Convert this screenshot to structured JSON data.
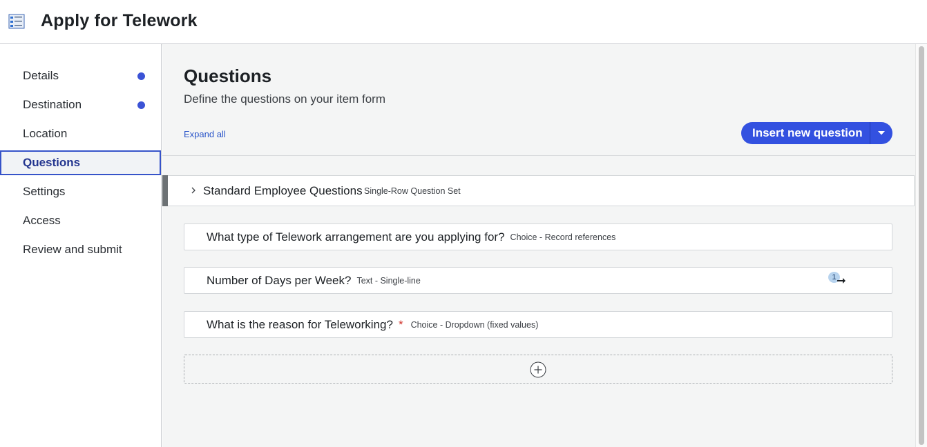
{
  "header": {
    "title": "Apply for Telework",
    "icon": "catalog-item-form-icon"
  },
  "sidebar": {
    "items": [
      {
        "label": "Details",
        "dot": true
      },
      {
        "label": "Destination",
        "dot": true
      },
      {
        "label": "Location",
        "dot": false
      },
      {
        "label": "Questions",
        "dot": false,
        "active": true
      },
      {
        "label": "Settings",
        "dot": false
      },
      {
        "label": "Access",
        "dot": false
      },
      {
        "label": "Review and submit",
        "dot": false
      }
    ]
  },
  "main": {
    "title": "Questions",
    "subtitle": "Define the questions on your item form",
    "expand_all": "Expand all",
    "insert_button": "Insert new question",
    "question_set": {
      "title": "Standard Employee Questions",
      "type": "Single-Row Question Set"
    },
    "questions": [
      {
        "label": "What type of Telework arrangement are you applying for?",
        "type": "Choice - Record references",
        "required": false
      },
      {
        "label": "Number of Days per Week?",
        "type": "Text - Single-line",
        "required": false,
        "badge": "1"
      },
      {
        "label": "What is the reason for Teleworking?",
        "type": "Choice - Dropdown (fixed values)",
        "required": true,
        "required_mark": "*"
      }
    ]
  },
  "colors": {
    "accent": "#3351e0",
    "active_nav_border": "#3653c9",
    "dot": "#3b53d6",
    "required": "#d0342c"
  }
}
